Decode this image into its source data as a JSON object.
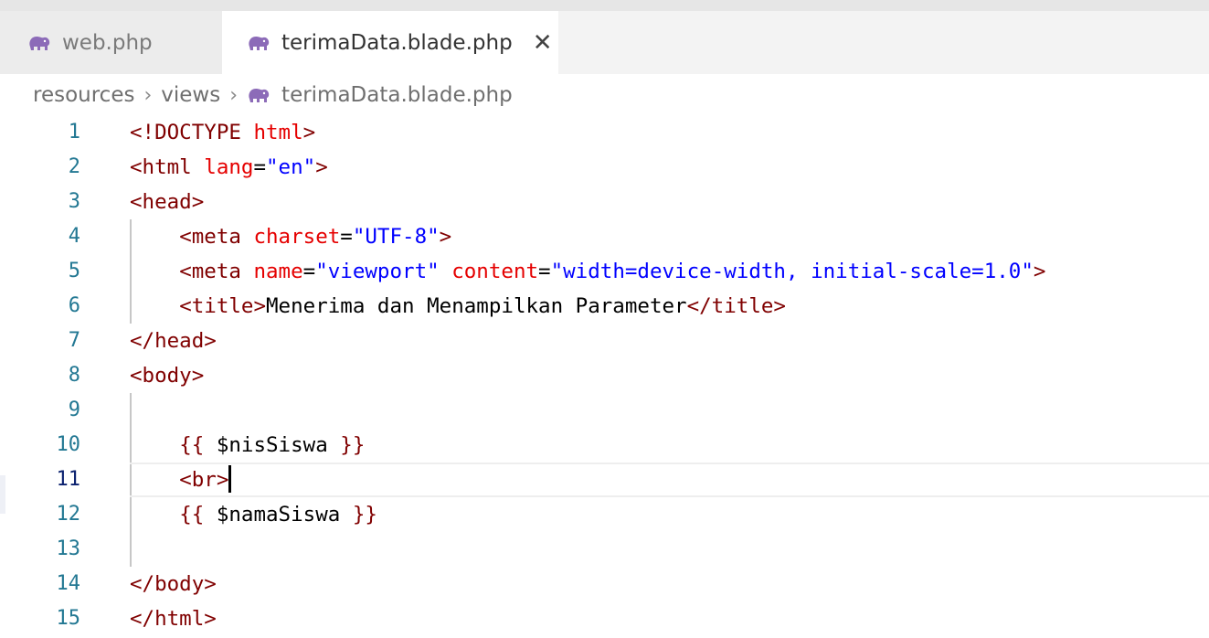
{
  "tabs": [
    {
      "label": "web.php",
      "icon": "php-elephant-icon",
      "active": false
    },
    {
      "label": "terimaData.blade.php",
      "icon": "php-elephant-icon",
      "active": true,
      "close_glyph": "✕"
    }
  ],
  "breadcrumb": {
    "items": [
      "resources",
      "views",
      "terimaData.blade.php"
    ],
    "separator": "›"
  },
  "editor": {
    "active_line": 11,
    "lines": [
      {
        "num": "1",
        "tokens": [
          [
            "tag",
            "<!DOCTYPE "
          ],
          [
            "attr",
            "html"
          ],
          [
            "tag",
            ">"
          ]
        ]
      },
      {
        "num": "2",
        "tokens": [
          [
            "tag",
            "<html "
          ],
          [
            "attr",
            "lang"
          ],
          [
            "txt",
            "="
          ],
          [
            "str",
            "\"en\""
          ],
          [
            "tag",
            ">"
          ]
        ]
      },
      {
        "num": "3",
        "tokens": [
          [
            "tag",
            "<head>"
          ]
        ]
      },
      {
        "num": "4",
        "tokens": [
          [
            "txt",
            "    "
          ],
          [
            "tag",
            "<meta "
          ],
          [
            "attr",
            "charset"
          ],
          [
            "txt",
            "="
          ],
          [
            "str",
            "\"UTF-8\""
          ],
          [
            "tag",
            ">"
          ]
        ]
      },
      {
        "num": "5",
        "tokens": [
          [
            "txt",
            "    "
          ],
          [
            "tag",
            "<meta "
          ],
          [
            "attr",
            "name"
          ],
          [
            "txt",
            "="
          ],
          [
            "str",
            "\"viewport\""
          ],
          [
            "txt",
            " "
          ],
          [
            "attr",
            "content"
          ],
          [
            "txt",
            "="
          ],
          [
            "str",
            "\"width=device-width, initial-scale=1.0\""
          ],
          [
            "tag",
            ">"
          ]
        ]
      },
      {
        "num": "6",
        "tokens": [
          [
            "txt",
            "    "
          ],
          [
            "tag",
            "<title>"
          ],
          [
            "txt",
            "Menerima dan Menampilkan Parameter"
          ],
          [
            "tag",
            "</title>"
          ]
        ]
      },
      {
        "num": "7",
        "tokens": [
          [
            "tag",
            "</head>"
          ]
        ]
      },
      {
        "num": "8",
        "tokens": [
          [
            "tag",
            "<body>"
          ]
        ]
      },
      {
        "num": "9",
        "tokens": []
      },
      {
        "num": "10",
        "tokens": [
          [
            "txt",
            "    "
          ],
          [
            "tag",
            "{{"
          ],
          [
            "txt",
            " $nisSiswa "
          ],
          [
            "tag",
            "}}"
          ]
        ]
      },
      {
        "num": "11",
        "tokens": [
          [
            "txt",
            "    "
          ],
          [
            "tag",
            "<br>"
          ]
        ]
      },
      {
        "num": "12",
        "tokens": [
          [
            "txt",
            "    "
          ],
          [
            "tag",
            "{{"
          ],
          [
            "txt",
            " $namaSiswa "
          ],
          [
            "tag",
            "}}"
          ]
        ]
      },
      {
        "num": "13",
        "tokens": []
      },
      {
        "num": "14",
        "tokens": [
          [
            "tag",
            "</body>"
          ]
        ]
      },
      {
        "num": "15",
        "tokens": [
          [
            "tag",
            "</html>"
          ]
        ]
      }
    ]
  },
  "colors": {
    "tag": "#800000",
    "attribute": "#e50000",
    "string": "#0000ff",
    "line_number": "#237893",
    "active_line_number": "#0b216f",
    "php_icon": "#8c6bb8"
  }
}
